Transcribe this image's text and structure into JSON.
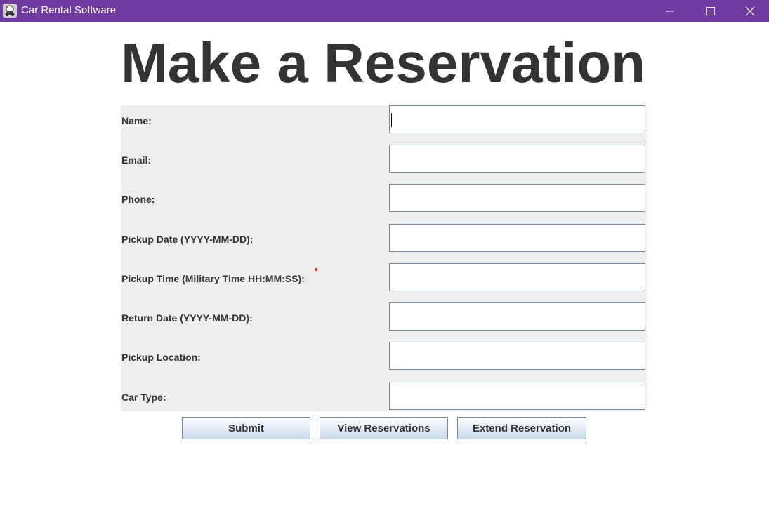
{
  "window": {
    "title": "Car Rental Software",
    "titlebar_color": "#6f3ba0",
    "controls": [
      "minimize-icon",
      "maximize-icon",
      "close-icon"
    ]
  },
  "page": {
    "heading": "Make a Reservation"
  },
  "form": {
    "fields": [
      {
        "label": "Name:",
        "value": ""
      },
      {
        "label": "Email:",
        "value": ""
      },
      {
        "label": "Phone:",
        "value": ""
      },
      {
        "label": "Pickup Date (YYYY-MM-DD):",
        "value": ""
      },
      {
        "label": "Pickup Time (Military Time HH:MM:SS):",
        "value": ""
      },
      {
        "label": "Return Date (YYYY-MM-DD):",
        "value": ""
      },
      {
        "label": "Pickup Location:",
        "value": ""
      },
      {
        "label": "Car Type:",
        "value": ""
      }
    ]
  },
  "actions": {
    "submit": "Submit",
    "view": "View Reservations",
    "extend": "Extend Reservation"
  }
}
